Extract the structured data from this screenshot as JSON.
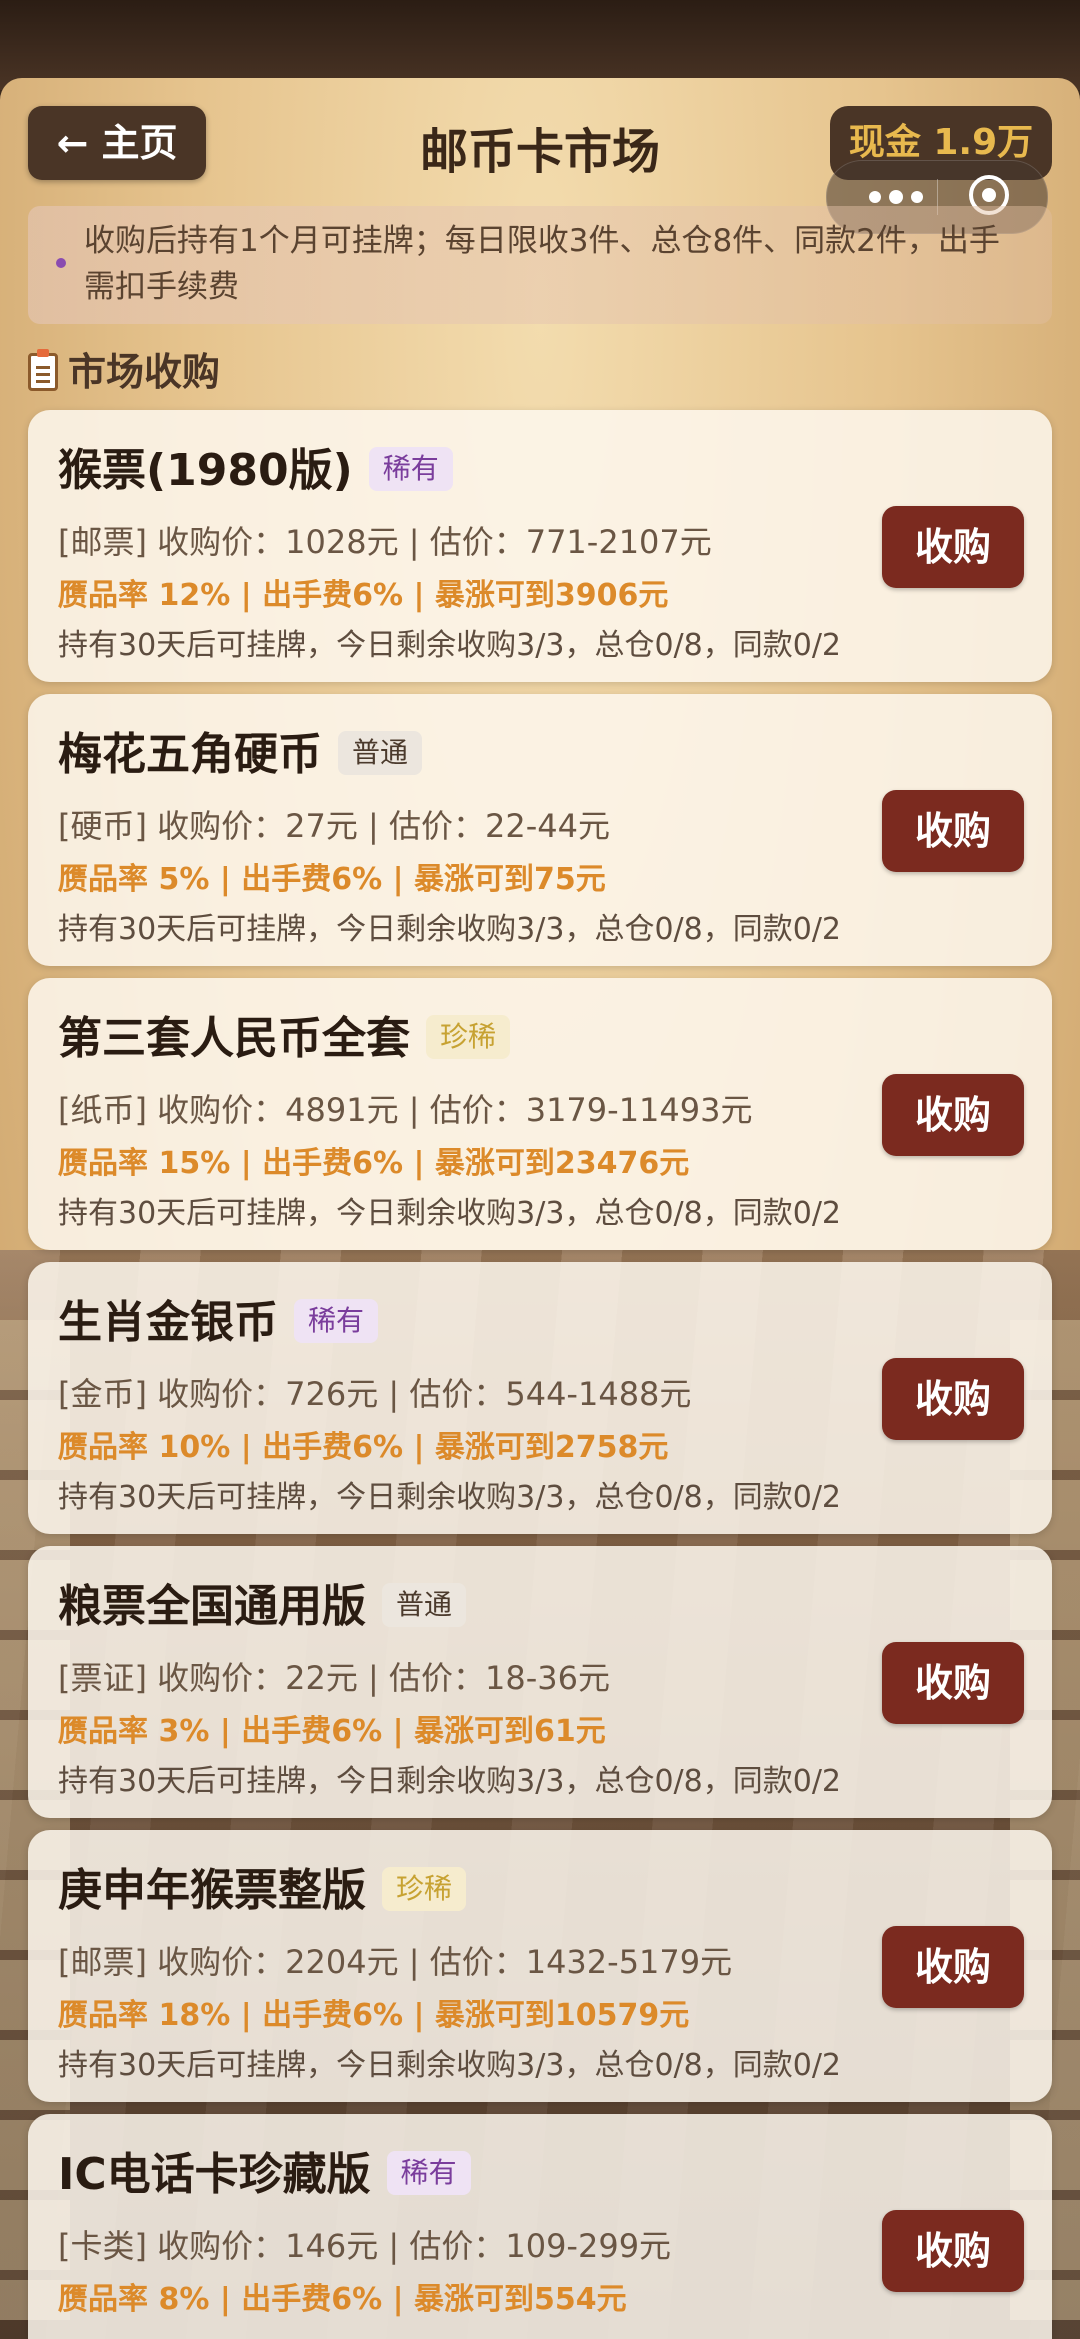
{
  "header": {
    "back_label": "← 主页",
    "title": "邮币卡市场",
    "cash_label": "现金 1.9万"
  },
  "notice": {
    "text": "收购后持有1个月可挂牌；每日限收3件、总仓8件、同款2件，出手需扣手续费"
  },
  "section": {
    "title": "市场收购"
  },
  "items": [
    {
      "name": "猴票(1980版)",
      "tag": "稀有",
      "tag_type": "rare",
      "line1": "[邮票] 收购价：1028元 | 估价：771-2107元",
      "line2": "赝品率 12% | 出手费6% | 暴涨可到3906元",
      "line3": "持有30天后可挂牌，今日剩余收购3/3，总仓0/8，同款0/2",
      "button": "收购"
    },
    {
      "name": "梅花五角硬币",
      "tag": "普通",
      "tag_type": "normal",
      "line1": "[硬币] 收购价：27元 | 估价：22-44元",
      "line2": "赝品率 5% | 出手费6% | 暴涨可到75元",
      "line3": "持有30天后可挂牌，今日剩余收购3/3，总仓0/8，同款0/2",
      "button": "收购"
    },
    {
      "name": "第三套人民币全套",
      "tag": "珍稀",
      "tag_type": "precious",
      "line1": "[纸币] 收购价：4891元 | 估价：3179-11493元",
      "line2": "赝品率 15% | 出手费6% | 暴涨可到23476元",
      "line3": "持有30天后可挂牌，今日剩余收购3/3，总仓0/8，同款0/2",
      "button": "收购"
    },
    {
      "name": "生肖金银币",
      "tag": "稀有",
      "tag_type": "rare",
      "line1": "[金币] 收购价：726元 | 估价：544-1488元",
      "line2": "赝品率 10% | 出手费6% | 暴涨可到2758元",
      "line3": "持有30天后可挂牌，今日剩余收购3/3，总仓0/8，同款0/2",
      "button": "收购"
    },
    {
      "name": "粮票全国通用版",
      "tag": "普通",
      "tag_type": "normal",
      "line1": "[票证] 收购价：22元 | 估价：18-36元",
      "line2": "赝品率 3% | 出手费6% | 暴涨可到61元",
      "line3": "持有30天后可挂牌，今日剩余收购3/3，总仓0/8，同款0/2",
      "button": "收购"
    },
    {
      "name": "庚申年猴票整版",
      "tag": "珍稀",
      "tag_type": "precious",
      "line1": "[邮票] 收购价：2204元 | 估价：1432-5179元",
      "line2": "赝品率 18% | 出手费6% | 暴涨可到10579元",
      "line3": "持有30天后可挂牌，今日剩余收购3/3，总仓0/8，同款0/2",
      "button": "收购"
    },
    {
      "name": "IC电话卡珍藏版",
      "tag": "稀有",
      "tag_type": "rare",
      "line1": "[卡类] 收购价：146元 | 估价：109-299元",
      "line2": "赝品率 8% | 出手费6% | 暴涨可到554元",
      "line3": "",
      "button": "收购"
    }
  ]
}
